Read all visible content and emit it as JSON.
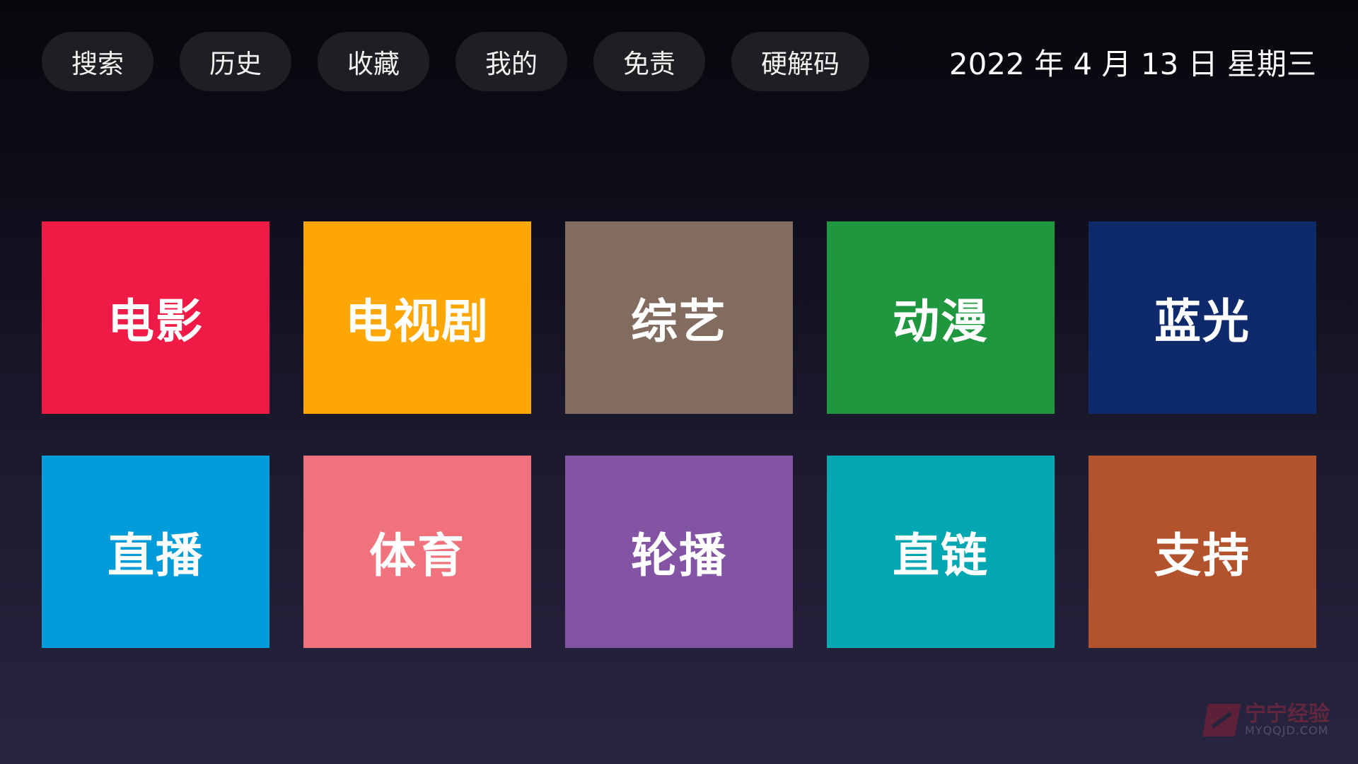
{
  "nav": {
    "items": [
      {
        "id": "search",
        "label": "搜索"
      },
      {
        "id": "history",
        "label": "历史"
      },
      {
        "id": "favorites",
        "label": "收藏"
      },
      {
        "id": "mine",
        "label": "我的"
      },
      {
        "id": "disclaimer",
        "label": "免责"
      },
      {
        "id": "hw-decode",
        "label": "硬解码"
      }
    ]
  },
  "header": {
    "date": "2022 年 4 月 13 日 星期三"
  },
  "tiles": [
    {
      "id": "movie",
      "label": "电影",
      "color": "#ef1a45"
    },
    {
      "id": "tv-series",
      "label": "电视剧",
      "color": "#fea603"
    },
    {
      "id": "variety",
      "label": "综艺",
      "color": "#826b5f"
    },
    {
      "id": "anime",
      "label": "动漫",
      "color": "#1f973f"
    },
    {
      "id": "bluray",
      "label": "蓝光",
      "color": "#0f2a6b"
    },
    {
      "id": "live",
      "label": "直播",
      "color": "#029cda"
    },
    {
      "id": "sports",
      "label": "体育",
      "color": "#ef727d"
    },
    {
      "id": "carousel",
      "label": "轮播",
      "color": "#8354a4"
    },
    {
      "id": "direct-link",
      "label": "直链",
      "color": "#02a7b1"
    },
    {
      "id": "support",
      "label": "支持",
      "color": "#b3532d"
    }
  ],
  "watermark": {
    "main": "宁宁经验",
    "sub": "MYQQJD.COM",
    "icon": "logo-icon"
  }
}
